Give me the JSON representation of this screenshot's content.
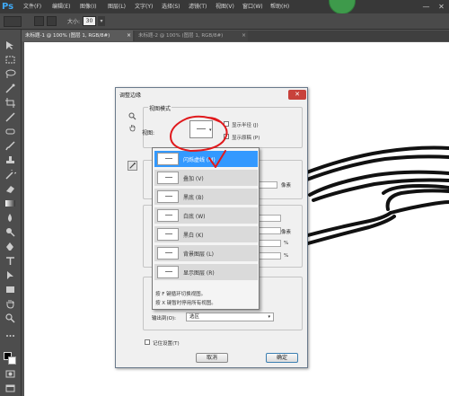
{
  "app": {
    "logo": "Ps"
  },
  "menu": [
    "文件(F)",
    "编辑(E)",
    "图像(I)",
    "图层(L)",
    "文字(Y)",
    "选择(S)",
    "滤镜(T)",
    "视图(V)",
    "窗口(W)",
    "帮助(H)"
  ],
  "window_controls": {
    "minimize": "—",
    "close": "✕"
  },
  "options_bar": {
    "size_label": "大小:",
    "size_value": "30"
  },
  "tabs": [
    {
      "label": "未标题-1 @ 100% (图层 1, RGB/8#)",
      "close": "×"
    },
    {
      "label": "未标题-2 @ 100% (图层 1, RGB/8#)",
      "close": "×"
    }
  ],
  "dialog": {
    "title": "调整边缘",
    "close": "✕",
    "view_mode_legend": "视图模式",
    "view_label": "视图:",
    "show_radius": "显示半径 (J)",
    "show_original": "显示原稿 (P)",
    "px_unit_1": "像素",
    "px_unit_2": "像素",
    "pct_1": "%",
    "pct_2": "%",
    "output_to_label": "输出到(O):",
    "output_to_value": "选区",
    "remember_settings": "记住设置(T)",
    "cancel": "取消",
    "ok": "确定"
  },
  "view_dropdown": {
    "items": [
      {
        "label": "闪烁虚线 (M)",
        "selected": true
      },
      {
        "label": "叠加 (V)",
        "selected": false
      },
      {
        "label": "黑底 (B)",
        "selected": false
      },
      {
        "label": "白底 (W)",
        "selected": false
      },
      {
        "label": "黑白 (K)",
        "selected": false
      },
      {
        "label": "背景图层 (L)",
        "selected": false
      },
      {
        "label": "显示图层 (R)",
        "selected": false
      }
    ],
    "hint_1": "按 F 键循环切换视图。",
    "hint_2": "按 X 键暂时停用所有视图。"
  },
  "annotations": {
    "color": "#e0191c"
  },
  "icons": {
    "zoom": "zoom-icon",
    "hand": "hand-icon",
    "brush": "brush-icon",
    "dropdown_arrow": "▾"
  }
}
